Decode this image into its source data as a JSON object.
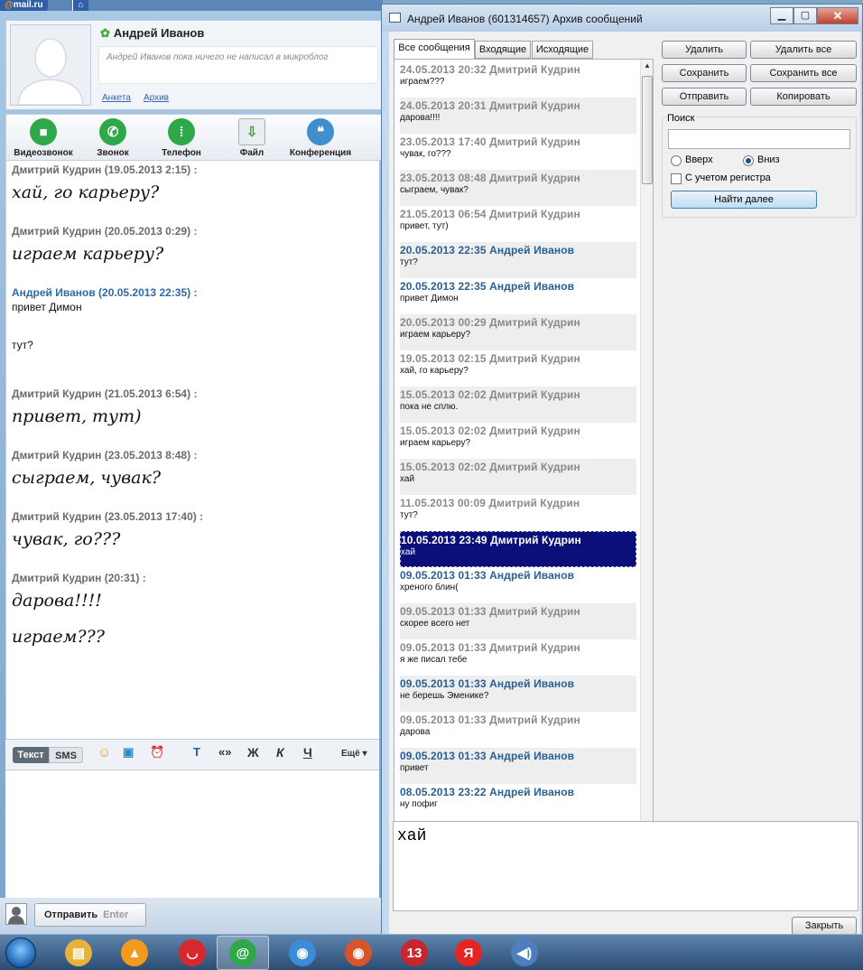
{
  "agent": {
    "logo_at": "@",
    "logo_text": "mail.ru",
    "home_icon": "⌂",
    "profile_name": "Андрей Иванов",
    "status_text": "Андрей Иванов пока ничего не написал в микроблог",
    "links": [
      "Анкета",
      "Архив"
    ],
    "tools": [
      {
        "label": "Видеозвонок",
        "icon": "video-camera",
        "color": "#2fa84a"
      },
      {
        "label": "Звонок",
        "icon": "phone",
        "color": "#2fa84a"
      },
      {
        "label": "Телефон",
        "icon": "phone-keypad",
        "color": "#2fa84a"
      },
      {
        "label": "Файл",
        "icon": "file-download",
        "color": "#4a9a3c"
      },
      {
        "label": "Конференция",
        "icon": "chat-bubbles",
        "color": "#3f8fcf"
      }
    ],
    "chat": [
      {
        "sender": "Дмитрий Кудрин (19.05.2013 2:15) :",
        "text": "хай, го карьеру?"
      },
      {
        "sender": "Дмитрий Кудрин (20.05.2013 0:29) :",
        "text": "играем карьеру?"
      },
      {
        "sender": "Андрей Иванов (20.05.2013 22:35) :",
        "lines": [
          "привет Димон",
          "тут?"
        ]
      },
      {
        "sender": "Дмитрий Кудрин (21.05.2013 6:54) :",
        "text": "привет, тут)"
      },
      {
        "sender": "Дмитрий Кудрин (23.05.2013 8:48) :",
        "text": "сыграем, чувак?"
      },
      {
        "sender": "Дмитрий Кудрин (23.05.2013 17:40) :",
        "text": "чувак, го???"
      },
      {
        "sender": "Дмитрий Кудрин (20:31) :",
        "lines": [
          "дарова!!!!",
          "играем???"
        ]
      }
    ],
    "format_tabs": [
      "Текст",
      "SMS"
    ],
    "format_buttons": [
      "«»",
      "Ж",
      "К",
      "Ч"
    ],
    "more_label": "Ещё",
    "send_label": "Отправить",
    "send_key": "Enter"
  },
  "archive": {
    "title": "Андрей Иванов (601314657) Архив сообщений",
    "window_buttons": [
      "▁",
      "▢",
      "✕"
    ],
    "tabs": [
      "Все сообщения",
      "Входящие",
      "Исходящие"
    ],
    "messages": [
      {
        "header": "24.05.2013 20:32 Дмитрий Кудрин",
        "body": "играем???",
        "me": false
      },
      {
        "header": "24.05.2013 20:31 Дмитрий Кудрин",
        "body": "дарова!!!!",
        "me": false
      },
      {
        "header": "23.05.2013 17:40 Дмитрий Кудрин",
        "body": "чувак, го???",
        "me": false
      },
      {
        "header": "23.05.2013 08:48 Дмитрий Кудрин",
        "body": "сыграем, чувак?",
        "me": false
      },
      {
        "header": "21.05.2013 06:54 Дмитрий Кудрин",
        "body": "привет, тут)",
        "me": false
      },
      {
        "header": "20.05.2013 22:35 Андрей Иванов",
        "body": "тут?",
        "me": true
      },
      {
        "header": "20.05.2013 22:35 Андрей Иванов",
        "body": "привет Димон",
        "me": true
      },
      {
        "header": "20.05.2013 00:29 Дмитрий Кудрин",
        "body": "играем карьеру?",
        "me": false
      },
      {
        "header": "19.05.2013 02:15 Дмитрий Кудрин",
        "body": "хай, го карьеру?",
        "me": false
      },
      {
        "header": "15.05.2013 02:02 Дмитрий Кудрин",
        "body": "пока не сплю.",
        "me": false
      },
      {
        "header": "15.05.2013 02:02 Дмитрий Кудрин",
        "body": "играем карьеру?",
        "me": false
      },
      {
        "header": "15.05.2013 02:02 Дмитрий Кудрин",
        "body": "хай",
        "me": false
      },
      {
        "header": "11.05.2013 00:09 Дмитрий Кудрин",
        "body": "тут?",
        "me": false
      },
      {
        "header": "10.05.2013 23:49 Дмитрий Кудрин",
        "body": "хай",
        "me": false,
        "selected": true
      },
      {
        "header": "09.05.2013 01:33 Андрей Иванов",
        "body": "хреного блин(",
        "me": true
      },
      {
        "header": "09.05.2013 01:33 Дмитрий Кудрин",
        "body": "скорее всего нет",
        "me": false
      },
      {
        "header": "09.05.2013 01:33 Дмитрий Кудрин",
        "body": "я же писал тебе",
        "me": false
      },
      {
        "header": "09.05.2013 01:33 Андрей Иванов",
        "body": "не берешь Эменике?",
        "me": true
      },
      {
        "header": "09.05.2013 01:33 Дмитрий Кудрин",
        "body": "дарова",
        "me": false
      },
      {
        "header": "09.05.2013 01:33 Андрей Иванов",
        "body": "привет",
        "me": true
      },
      {
        "header": "08.05.2013 23:22 Андрей Иванов",
        "body": "ну пофиг",
        "me": true
      }
    ],
    "buttons": [
      "Удалить",
      "Удалить все",
      "Сохранить",
      "Сохранить все",
      "Отправить",
      "Копировать"
    ],
    "search_label": "Поиск",
    "search_value": "",
    "radio_up": "Вверх",
    "radio_down": "Вниз",
    "radio_selected": "down",
    "case_label": "С учетом регистра",
    "case_checked": false,
    "find_next": "Найти далее",
    "preview_text": "хай",
    "close_label": "Закрыть"
  },
  "taskbar": {
    "items": [
      {
        "name": "explorer-icon",
        "glyph": "▤",
        "color": "#e8b23a"
      },
      {
        "name": "aimp-icon",
        "glyph": "▲",
        "color": "#f29a1b"
      },
      {
        "name": "lips-icon",
        "glyph": "◡",
        "color": "#d8282d"
      },
      {
        "name": "mail-agent-icon",
        "glyph": "@",
        "color": "#2fa84a",
        "active": true
      },
      {
        "name": "chrome-icon",
        "glyph": "◉",
        "color": "#3b8bd8"
      },
      {
        "name": "chrome-alt-icon",
        "glyph": "◉",
        "color": "#d9542b"
      },
      {
        "name": "badge-13-icon",
        "glyph": "13",
        "color": "#c8252d"
      },
      {
        "name": "yandex-icon",
        "glyph": "Я",
        "color": "#e52620"
      },
      {
        "name": "volume-icon",
        "glyph": "◀)",
        "color": "#4d7fc0"
      }
    ]
  }
}
